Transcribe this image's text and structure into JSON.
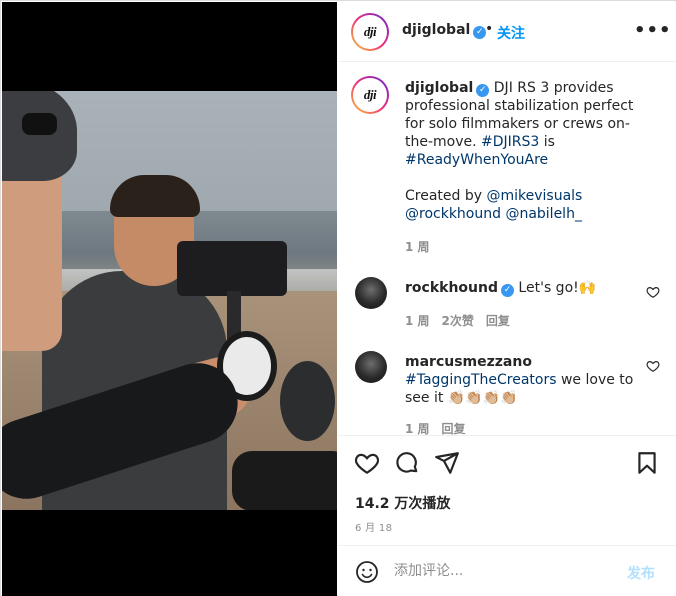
{
  "header": {
    "username": "djiglobal",
    "dot": "•",
    "follow_label": "关注",
    "more_label": "•••",
    "avatar_logo": "dji"
  },
  "caption": {
    "username": "djiglobal",
    "text_before": " DJI RS 3 provides professional stabilization perfect for solo filmmakers or crews on-the-move. ",
    "hashtag1": "#DJIRS3",
    "text_mid": " is ",
    "hashtag2": "#ReadyWhenYouAre",
    "created_by": "Created by ",
    "mention1": "@mikevisuals",
    "mention2": "@rockkhound",
    "mention3": "@nabilelh_",
    "time": "1 周"
  },
  "comments": [
    {
      "username": "rockkhound",
      "verified": true,
      "text": " Let's go!🙌",
      "time": "1 周",
      "likes": "2次赞",
      "reply": "回复"
    },
    {
      "username": "marcusmezzano",
      "verified": false,
      "hashtag": "#TaggingTheCreators",
      "text": " we love to see it 👏🏼👏🏼👏🏼👏🏼",
      "time": "1 周",
      "reply": "回复"
    }
  ],
  "actions": {
    "views": "14.2 万次播放",
    "date": "6 月 18"
  },
  "add_comment": {
    "placeholder": "添加评论...",
    "post_label": "发布"
  },
  "colors": {
    "accent": "#0095f6",
    "link": "#00376b",
    "verified": "#3897f0",
    "muted": "#8e8e8e"
  }
}
